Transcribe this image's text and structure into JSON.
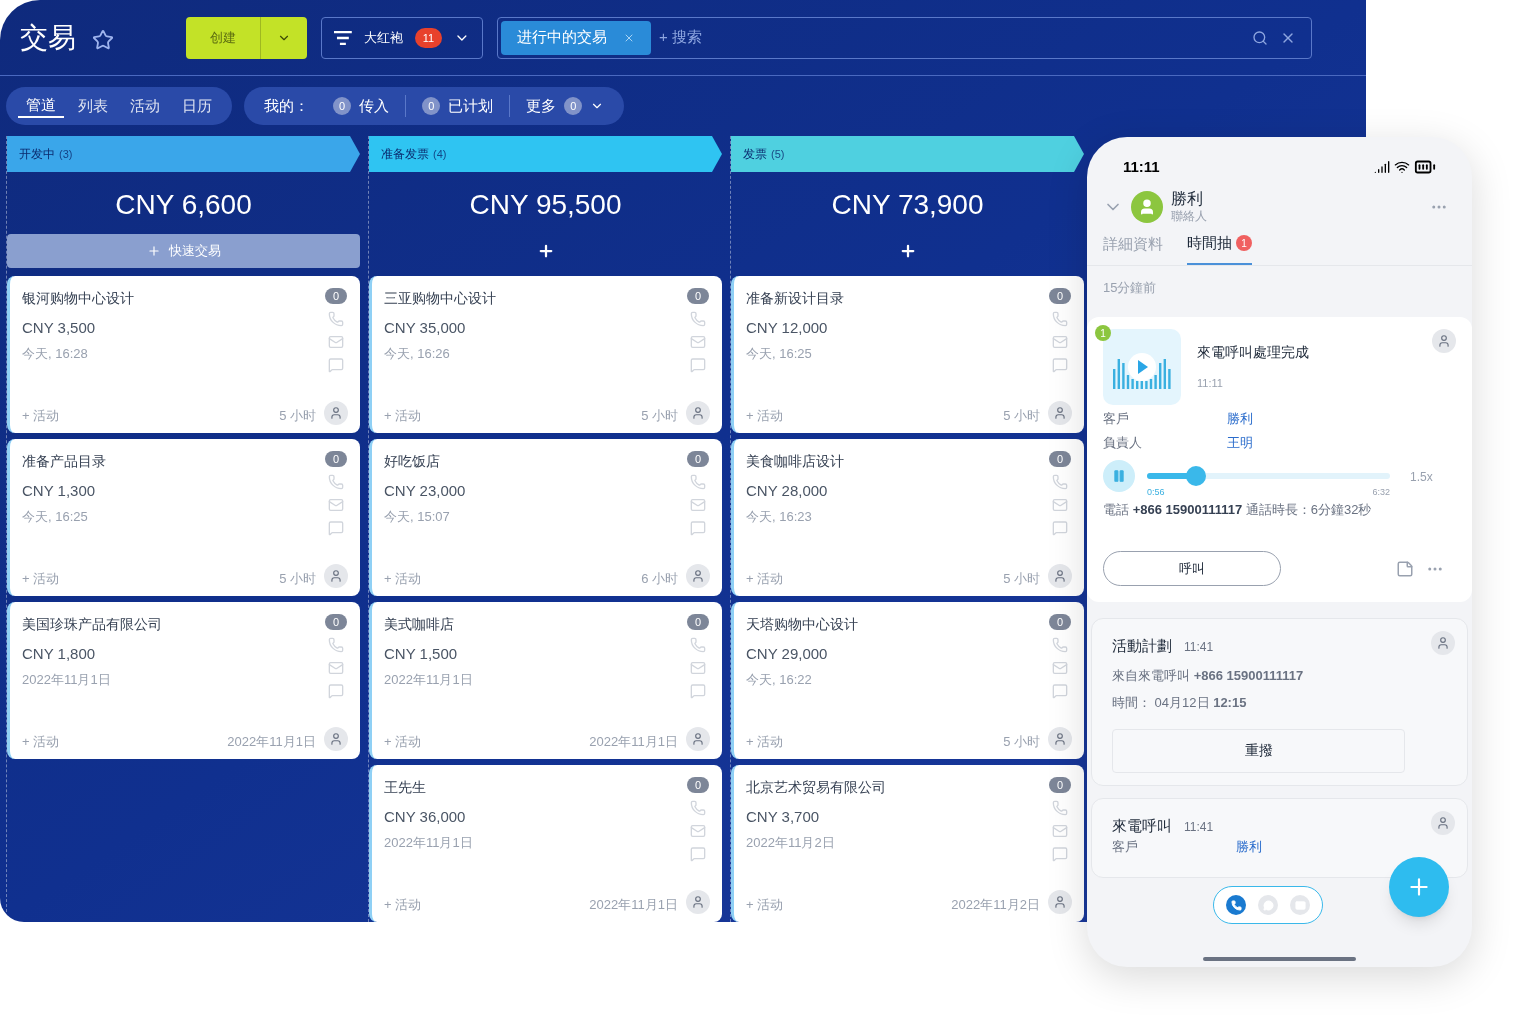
{
  "header": {
    "title": "交易",
    "create_button": "创建",
    "filter": {
      "label": "大红袍",
      "count": "11"
    },
    "search": {
      "chip": "进行中的交易",
      "placeholder": "+ 搜索"
    }
  },
  "views": [
    {
      "label": "管道",
      "selected": true
    },
    {
      "label": "列表",
      "selected": false
    },
    {
      "label": "活动",
      "selected": false
    },
    {
      "label": "日历",
      "selected": false
    }
  ],
  "my_filters": {
    "label": "我的：",
    "items": [
      {
        "kind": "count_first",
        "count": "0",
        "label": "传入"
      },
      {
        "kind": "count_first",
        "count": "0",
        "label": "已计划"
      },
      {
        "kind": "dropdown",
        "label": "更多",
        "count": "0"
      }
    ]
  },
  "columns": [
    {
      "name": "开发中",
      "count": "(3)",
      "color": "#3aa6ea",
      "total": "CNY 6,600",
      "quick_add_label": "快速交易",
      "cards": [
        {
          "title": "银河购物中心设计",
          "amount": "CNY 3,500",
          "date": "今天, 16:28",
          "activity": "+ 活动",
          "age": "5 小时",
          "badge": "0"
        },
        {
          "title": "准备产品目录",
          "amount": "CNY 1,300",
          "date": "今天, 16:25",
          "activity": "+ 活动",
          "age": "5 小时",
          "badge": "0"
        },
        {
          "title": "美国珍珠产品有限公司",
          "amount": "CNY 1,800",
          "date": "2022年11月1日",
          "activity": "+ 活动",
          "age": "2022年11月1日",
          "badge": "0"
        }
      ]
    },
    {
      "name": "准备发票",
      "count": "(4)",
      "color": "#2fc4f2",
      "total": "CNY 95,500",
      "cards": [
        {
          "title": "三亚购物中心设计",
          "amount": "CNY 35,000",
          "date": "今天, 16:26",
          "activity": "+ 活动",
          "age": "5 小时",
          "badge": "0"
        },
        {
          "title": "好吃饭店",
          "amount": "CNY 23,000",
          "date": "今天, 15:07",
          "activity": "+ 活动",
          "age": "6 小时",
          "badge": "0"
        },
        {
          "title": "美式咖啡店",
          "amount": "CNY 1,500",
          "date": "2022年11月1日",
          "activity": "+ 活动",
          "age": "2022年11月1日",
          "badge": "0"
        },
        {
          "title": "王先生",
          "amount": "CNY 36,000",
          "date": "2022年11月1日",
          "activity": "+ 活动",
          "age": "2022年11月1日",
          "badge": "0"
        }
      ]
    },
    {
      "name": "发票",
      "count": "(5)",
      "color": "#4fd0e0",
      "total": "CNY 73,900",
      "cards": [
        {
          "title": "准备新设计目录",
          "amount": "CNY 12,000",
          "date": "今天, 16:25",
          "activity": "+ 活动",
          "age": "5 小时",
          "badge": "0"
        },
        {
          "title": "美食咖啡店设计",
          "amount": "CNY 28,000",
          "date": "今天, 16:23",
          "activity": "+ 活动",
          "age": "5 小时",
          "badge": "0"
        },
        {
          "title": "天塔购物中心设计",
          "amount": "CNY 29,000",
          "date": "今天, 16:22",
          "activity": "+ 活动",
          "age": "5 小时",
          "badge": "0"
        },
        {
          "title": "北京艺术贸易有限公司",
          "amount": "CNY 3,700",
          "date": "2022年11月2日",
          "activity": "+ 活动",
          "age": "2022年11月2日",
          "badge": "0"
        }
      ]
    }
  ],
  "phone": {
    "time": "11:11",
    "contact": {
      "name": "勝利",
      "role": "聯絡人"
    },
    "tabs": [
      {
        "label": "詳細資料",
        "selected": false
      },
      {
        "label": "時間抽",
        "selected": true,
        "badge": "1"
      }
    ],
    "ago": "15分鐘前",
    "call_card": {
      "badge": "1",
      "title": "來電呼叫處理完成",
      "time": "11:11",
      "fields": [
        {
          "label": "客戶",
          "value": "勝利"
        },
        {
          "label": "負責人",
          "value": "王明"
        }
      ],
      "player": {
        "level": 0.2,
        "elapsed": "0:56",
        "total": "6:32",
        "speed": "1.5x"
      },
      "details": "電話 **+866 15900111117** 通話時長：6分鐘32秒",
      "button": "呼叫"
    },
    "plan_card": {
      "title": "活動計劃",
      "time": "11:41",
      "from": "來自來電呼叫 **+866 15900111117**",
      "when": "時間： 04月12日 **12:15**",
      "button": "重撥"
    },
    "incoming_card": {
      "title": "來電呼叫",
      "time": "11:41",
      "fields": [
        {
          "label": "客戶",
          "value": "勝利"
        }
      ]
    },
    "channels": [
      {
        "kind": "phone",
        "selected": true
      },
      {
        "kind": "chat",
        "selected": false
      },
      {
        "kind": "mail",
        "selected": false
      }
    ]
  }
}
